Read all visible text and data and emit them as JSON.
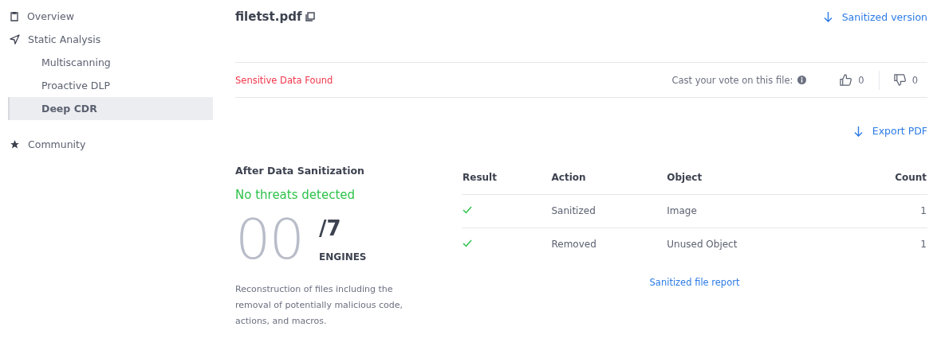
{
  "sidebar": {
    "items": [
      {
        "label": "Overview",
        "selected": false
      },
      {
        "label": "Static Analysis",
        "selected": false,
        "children": [
          {
            "label": "Multiscanning",
            "selected": false
          },
          {
            "label": "Proactive DLP",
            "selected": false
          },
          {
            "label": "Deep CDR",
            "selected": true
          }
        ]
      },
      {
        "label": "Community",
        "selected": false
      }
    ]
  },
  "file": {
    "name": "filetst.pdf",
    "download_link": "Sanitized version"
  },
  "status": {
    "label": "Sensitive Data Found",
    "vote_prompt": "Cast your vote on this file:",
    "upvotes": "0",
    "downvotes": "0"
  },
  "export_link": "Export PDF",
  "summary": {
    "title": "After Data Sanitization",
    "verdict": "No threats detected",
    "score": "00",
    "total": "/7",
    "unit": "ENGINES",
    "description": "Reconstruction of files including the removal of potentially malicious code, actions, and macros."
  },
  "table": {
    "columns": [
      "Result",
      "Action",
      "Object",
      "Count"
    ],
    "rows": [
      {
        "passed": true,
        "action": "Sanitized",
        "object": "Image",
        "count": "1"
      },
      {
        "passed": true,
        "action": "Removed",
        "object": "Unused Object",
        "count": "1"
      }
    ]
  },
  "report_link": "Sanitized file report"
}
